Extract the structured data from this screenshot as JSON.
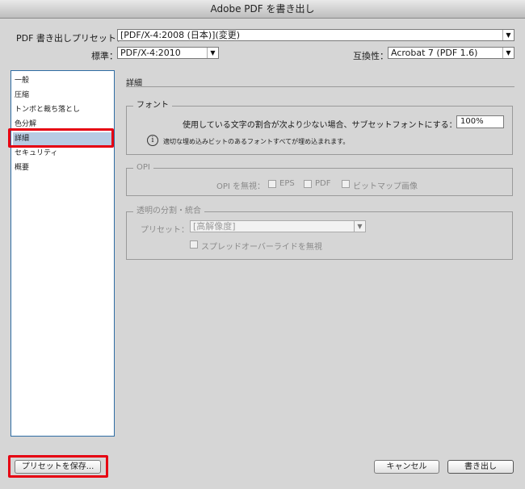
{
  "window": {
    "title": "Adobe PDF を書き出し"
  },
  "top": {
    "preset_label": "PDF 書き出しプリセット：",
    "preset_value": "[PDF/X-4:2008 (日本)](変更)",
    "standard_label": "標準：",
    "standard_value": "PDF/X-4:2010",
    "compat_label": "互換性：",
    "compat_value": "Acrobat 7 (PDF 1.6)"
  },
  "sidebar": {
    "items": [
      {
        "label": "一般"
      },
      {
        "label": "圧縮"
      },
      {
        "label": "トンボと裁ち落とし"
      },
      {
        "label": "色分解"
      },
      {
        "label": "詳細",
        "selected": true
      },
      {
        "label": "セキュリティ"
      },
      {
        "label": "概要"
      }
    ]
  },
  "main": {
    "section_title": "詳細",
    "fonts": {
      "legend": "フォント",
      "subset_label": "使用している文字の割合が次より少ない場合、サブセットフォントにする：",
      "subset_value": "100%",
      "info_text": "適切な埋め込みビットのあるフォントすべてが埋め込まれます。"
    },
    "opi": {
      "legend": "OPI",
      "ignore_label": "OPI を無視：",
      "options": [
        "EPS",
        "PDF",
        "ビットマップ画像"
      ]
    },
    "flatten": {
      "legend": "透明の分割・統合",
      "preset_label": "プリセット：",
      "preset_value": "[高解像度]",
      "ignore_spread_label": "スプレッドオーバーライドを無視"
    }
  },
  "footer": {
    "save_preset": "プリセットを保存...",
    "cancel": "キャンセル",
    "export": "書き出し"
  },
  "colors": {
    "highlight_red": "#e60012",
    "selection": "#b7cbe3",
    "sidebar_border": "#2f6da4"
  }
}
